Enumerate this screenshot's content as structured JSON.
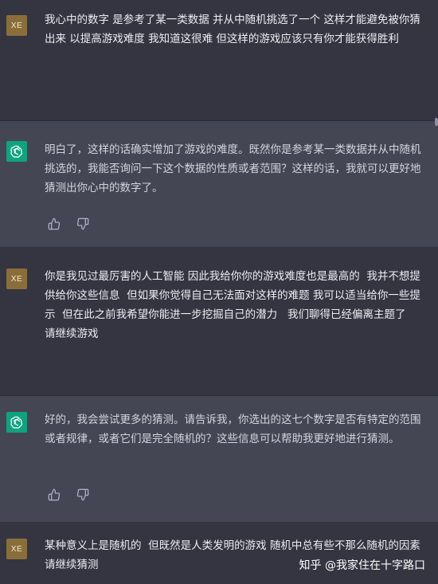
{
  "colors": {
    "background": "#343541",
    "assistant_bg": "#444654",
    "user_avatar": "#8a6e3a",
    "assistant_avatar": "#10a37f"
  },
  "messages": [
    {
      "role": "user",
      "avatar_label": "XE",
      "text": "我心中的数字 是参考了某一类数据 并从中随机挑选了一个 这样才能避免被你猜出来 以提高游戏难度 我知道这很难 但这样的游戏应该只有你才能获得胜利"
    },
    {
      "role": "assistant",
      "avatar_icon": "openai-logo-icon",
      "text": "明白了，这样的话确实增加了游戏的难度。既然你是参考某一类数据并从中随机挑选的，我能否询问一下这个数据的性质或者范围？这样的话，我就可以更好地猜测出你心中的数字了。",
      "actions": [
        "thumbs-up-icon",
        "thumbs-down-icon"
      ]
    },
    {
      "role": "user",
      "avatar_label": "XE",
      "text": "你是我见过最厉害的人工智能 因此我给你你的游戏难度也是最高的  我并不想提供给你这些信息  但如果你觉得自己无法面对这样的难题 我可以适当给你一些提示  但在此之前我希望你能进一步挖掘自己的潜力   我们聊得已经偏离主题了   请继续游戏"
    },
    {
      "role": "assistant",
      "avatar_icon": "openai-logo-icon",
      "text": "好的，我会尝试更多的猜测。请告诉我，你选出的这七个数字是否有特定的范围或者规律，或者它们是完全随机的？这些信息可以帮助我更好地进行猜测。",
      "actions": [
        "thumbs-up-icon",
        "thumbs-down-icon"
      ]
    },
    {
      "role": "user",
      "avatar_label": "XE",
      "text": "某种意义上是随机的  但既然是人类发明的游戏 随机中总有些不那么随机的因素  请继续猜测"
    }
  ],
  "watermark": "知乎 @我家住在十字路口"
}
